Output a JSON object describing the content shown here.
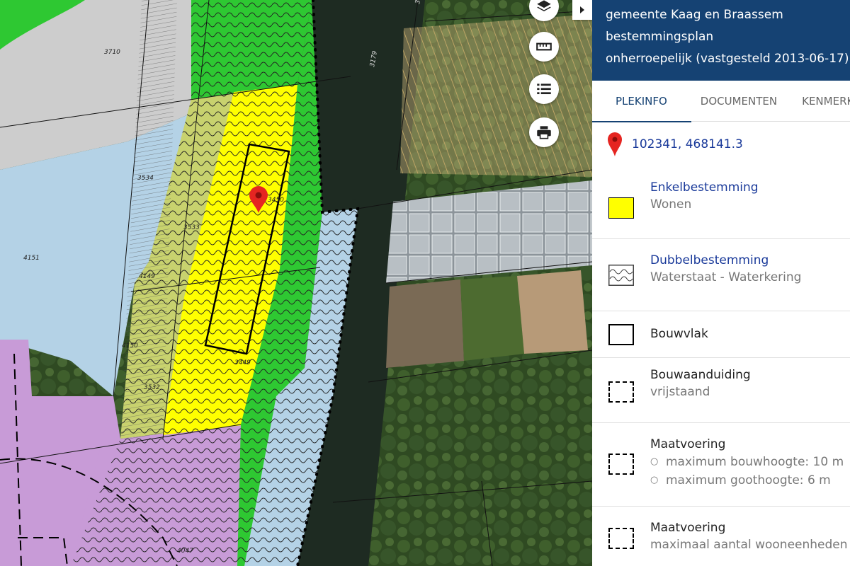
{
  "map": {
    "parcel_labels": [
      "3710",
      "3534",
      "3533",
      "4151",
      "4149",
      "4150",
      "3532",
      "3450",
      "3449",
      "4047",
      "3179",
      "3"
    ],
    "controls": [
      {
        "name": "layers-icon"
      },
      {
        "name": "ruler-icon"
      },
      {
        "name": "list-icon"
      },
      {
        "name": "print-icon"
      }
    ]
  },
  "panel": {
    "header": {
      "line1": "gemeente Kaag en Braassem",
      "line2": "bestemmingsplan",
      "line3": "onherroepelijk (vastgesteld 2013-06-17)"
    },
    "tabs": [
      {
        "label": "PLEKINFO",
        "active": true
      },
      {
        "label": "DOCUMENTEN",
        "active": false
      },
      {
        "label": "KENMERKEN",
        "active": false
      }
    ],
    "coordinates": "102341, 468141.3",
    "legend": [
      {
        "title": "Enkelbestemming",
        "subtitle": "Wonen",
        "swatch": "yellow-fill",
        "color": "#ffff00"
      },
      {
        "title": "Dubbelbestemming",
        "subtitle": "Waterstaat - Waterkering",
        "swatch": "wave-pattern"
      },
      {
        "title": "Bouwvlak",
        "subtitle": "",
        "swatch": "solid-outline"
      },
      {
        "title": "Bouwaanduiding",
        "subtitle": "vrijstaand",
        "swatch": "dashed-outline"
      },
      {
        "title": "Maatvoering",
        "items": [
          "maximum bouwhoogte: 10 m",
          "maximum goothoogte: 6 m"
        ],
        "swatch": "dashed-outline"
      },
      {
        "title": "Maatvoering",
        "subtitle": "maximaal aantal wooneenheden",
        "swatch": "dashed-outline"
      }
    ]
  },
  "colors": {
    "header_bg": "#154273",
    "link": "#1a3a9a",
    "wonen": "#ffff00",
    "groen": "#2ec832",
    "agrarisch": "#c8d26e",
    "water": "#b4d2e6",
    "gemengd": "#c89bd7",
    "marker": "#e52521"
  }
}
